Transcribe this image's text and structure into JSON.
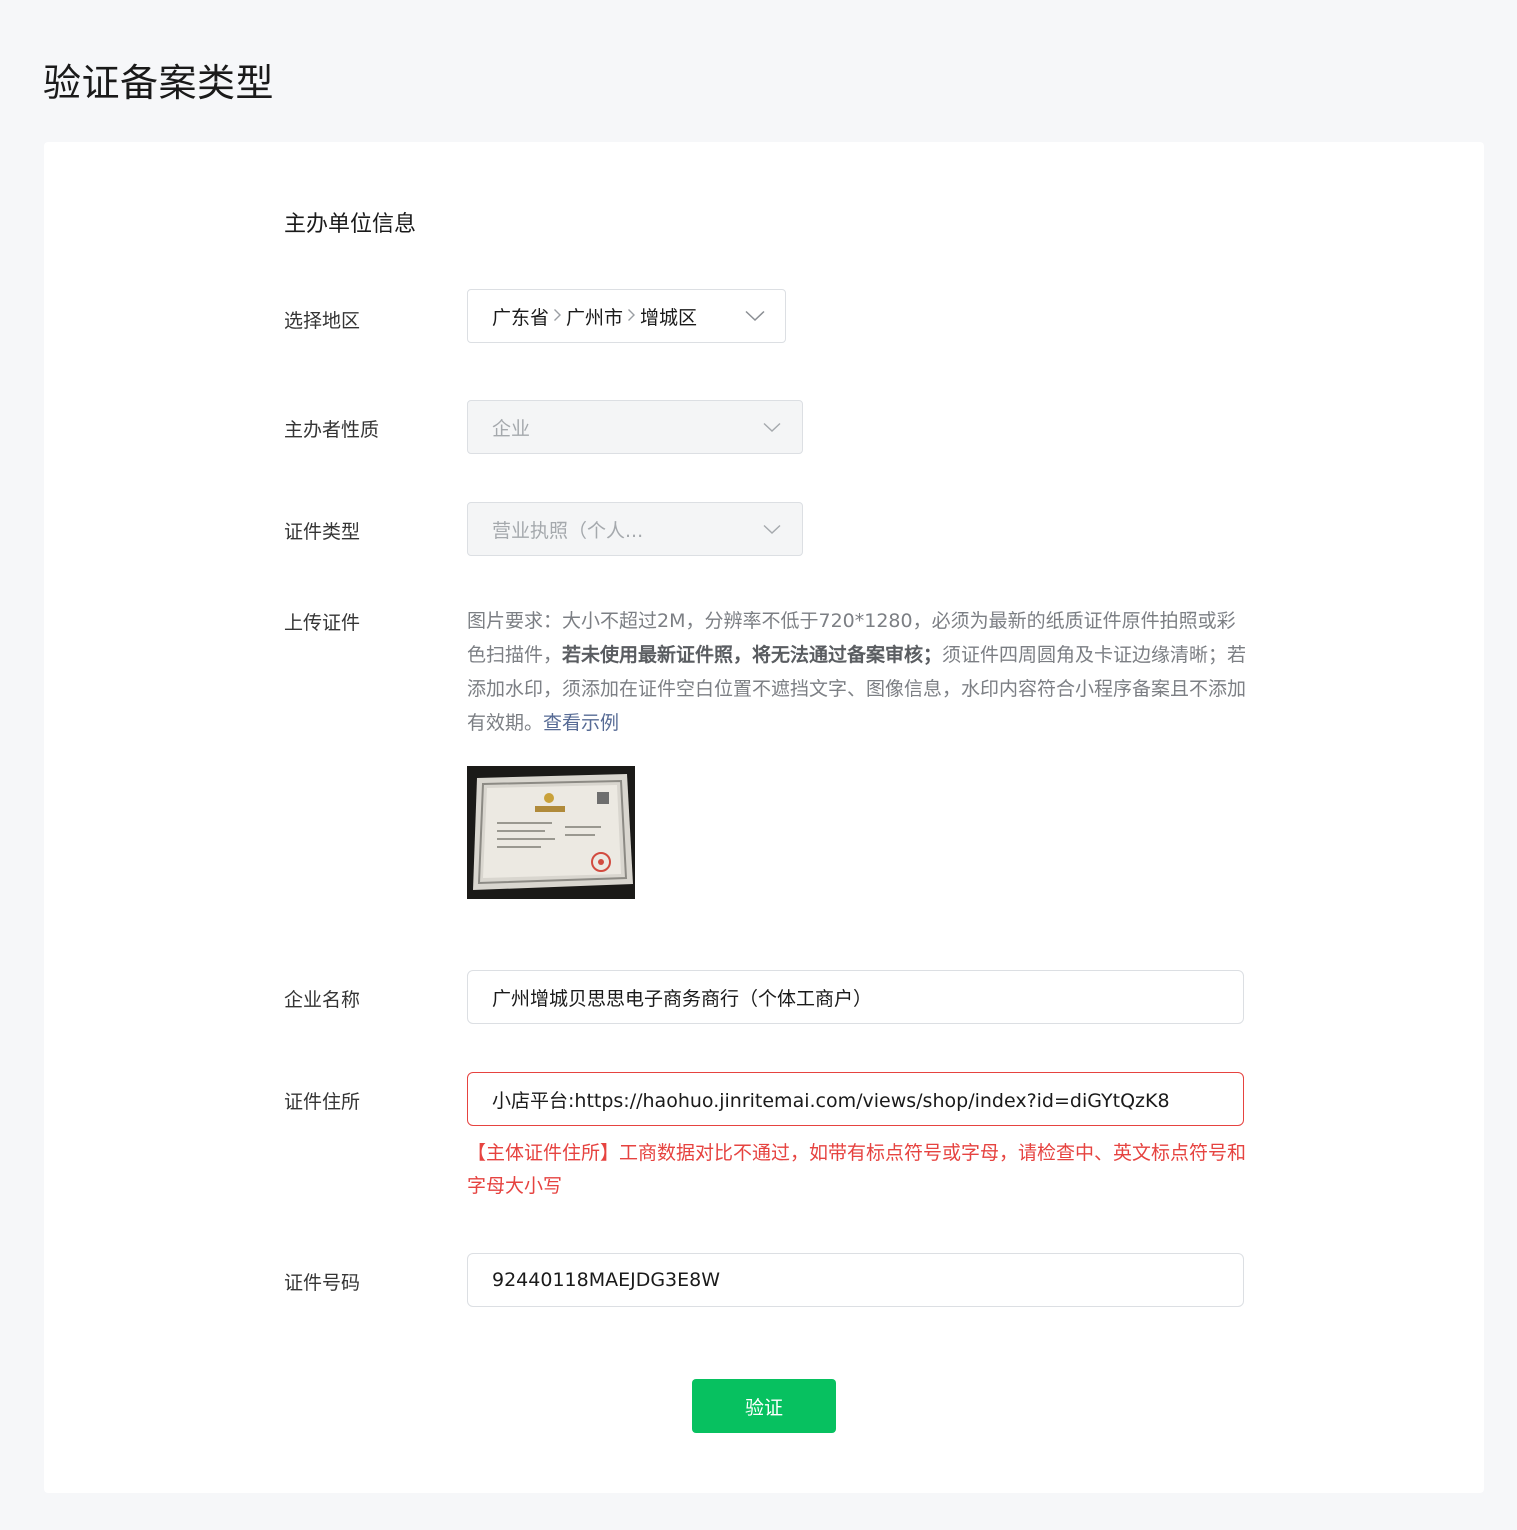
{
  "page": {
    "title": "验证备案类型"
  },
  "section": {
    "title": "主办单位信息"
  },
  "region": {
    "label": "选择地区",
    "province": "广东省",
    "city": "广州市",
    "district": "增城区"
  },
  "nature": {
    "label": "主办者性质",
    "value": "企业"
  },
  "cert_type": {
    "label": "证件类型",
    "value": "营业执照（个人..."
  },
  "upload": {
    "label": "上传证件",
    "hint_part1": "图片要求：大小不超过2M，分辨率不低于720*1280，必须为最新的纸质证件原件拍照或彩色扫描件，",
    "hint_bold": "若未使用最新证件照，将无法通过备案审核；",
    "hint_part2": "须证件四周圆角及卡证边缘清晰；若添加水印，须添加在证件空白位置不遮挡文字、图像信息，水印内容符合小程序备案且不添加有效期。",
    "example_link": "查看示例"
  },
  "company": {
    "label": "企业名称",
    "value": "广州增城贝思思电子商务商行（个体工商户）"
  },
  "address": {
    "label": "证件住所",
    "value": "小店平台:https://haohuo.jinritemai.com/views/shop/index?id=diGYtQzK8",
    "error": "【主体证件住所】工商数据对比不通过，如带有标点符号或字母，请检查中、英文标点符号和字母大小写"
  },
  "cert_number": {
    "label": "证件号码",
    "value": "92440118MAEJDG3E8W"
  },
  "submit": {
    "label": "验证"
  },
  "colors": {
    "primary": "#07c160",
    "error": "#e64340",
    "link": "#576b95"
  }
}
